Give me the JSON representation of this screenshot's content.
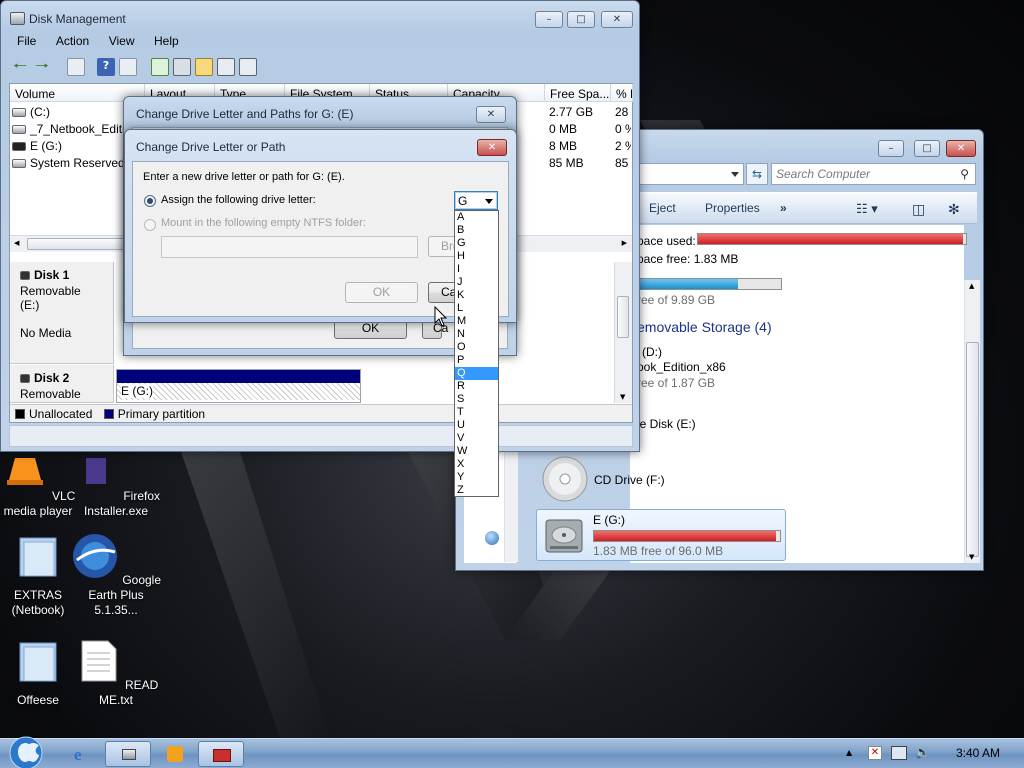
{
  "disk_management": {
    "title": "Disk Management",
    "menu": [
      "File",
      "Action",
      "View",
      "Help"
    ],
    "columns": [
      "Volume",
      "Layout",
      "Type",
      "File System",
      "Status",
      "Capacity",
      "Free Spa...",
      "% F"
    ],
    "volumes": [
      {
        "name": "(C:)",
        "free": "2.77 GB",
        "pct": "28"
      },
      {
        "name": "_7_Netbook_Editio",
        "free": "0 MB",
        "pct": "0 %"
      },
      {
        "name": "E (G:)",
        "free": "8 MB",
        "pct": "2 %"
      },
      {
        "name": "System Reserved",
        "free": "85 MB",
        "pct": "85"
      }
    ],
    "disk1": {
      "name": "Disk 1",
      "type": "Removable (E:)",
      "status": "No Media"
    },
    "disk2": {
      "name": "Disk 2",
      "type": "Removable",
      "partition": "E (G:)"
    },
    "legend": {
      "unallocated": "Unallocated",
      "primary": "Primary partition"
    }
  },
  "paths_dialog": {
    "title": "Change Drive Letter and Paths for G: (E)",
    "ok_label": "OK",
    "cancel_label": "Ca"
  },
  "change_dialog": {
    "title": "Change Drive Letter or Path",
    "prompt": "Enter a new drive letter or path for G: (E).",
    "assign_label": "Assign the following drive letter:",
    "mount_label": "Mount in the following empty NTFS folder:",
    "browse_label": "Bro",
    "ok_label": "OK",
    "cancel_label": "Ca",
    "selected_letter": "G",
    "letters": [
      "A",
      "B",
      "G",
      "H",
      "I",
      "J",
      "K",
      "L",
      "M",
      "N",
      "O",
      "P",
      "Q",
      "R",
      "S",
      "T",
      "U",
      "V",
      "W",
      "X",
      "Y",
      "Z"
    ],
    "highlighted_letter": "Q"
  },
  "computer_window": {
    "search_placeholder": "Search Computer",
    "commands": [
      "Eject",
      "Properties",
      "»"
    ],
    "space_used_label": "pace used:",
    "space_free_label": "pace free: 1.83 MB",
    "disk_free_partial": "ree of 9.89 GB",
    "section_header": "emovable Storage (4)",
    "drive_d_label": "(D:)",
    "drive_d_name": "ook_Edition_x86",
    "drive_d_free": "ree of 1.87 GB",
    "drive_e_label": "le Disk (E:)",
    "cd_label": "CD Drive (F:)",
    "g_label": "E (G:)",
    "g_free": "1.83 MB free of 96.0 MB",
    "g_fill": 0.98,
    "c_fill": 0.7,
    "used_fill": 0.99
  },
  "desktop_icons": [
    {
      "label": "VLC media player",
      "icon": "vlc-icon"
    },
    {
      "label": "Firefox Installer.exe",
      "icon": "firefox-installer-icon"
    },
    {
      "label": "EXTRAS (Netbook)",
      "icon": "folder-icon"
    },
    {
      "label": "Google Earth Plus 5.1.35...",
      "icon": "google-earth-icon"
    },
    {
      "label": "Offeese",
      "icon": "folder-icon"
    },
    {
      "label": "READ ME.txt",
      "icon": "text-file-icon"
    }
  ],
  "taskbar": {
    "clock": "3:40 AM"
  },
  "colors": {
    "primary_partition": "#00007a",
    "used_bar": "#d32b2b",
    "free_bar": "#2a9ad6",
    "highlight": "#3399ff"
  }
}
